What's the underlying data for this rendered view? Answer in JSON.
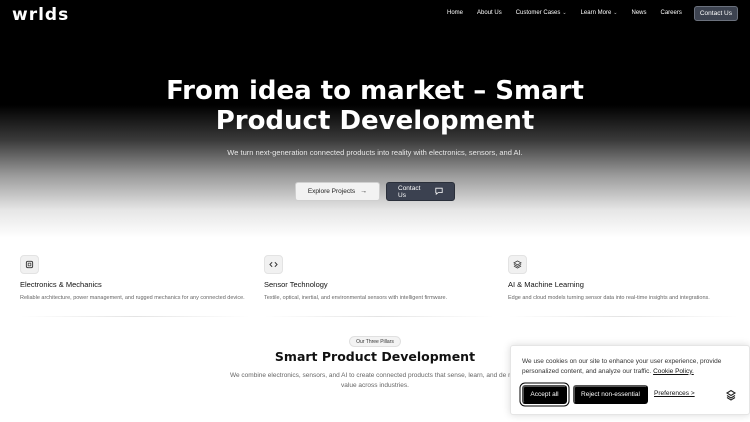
{
  "brand": {
    "logo": "wrlds"
  },
  "nav": {
    "items": [
      {
        "label": "Home",
        "has_dropdown": false
      },
      {
        "label": "About Us",
        "has_dropdown": false
      },
      {
        "label": "Customer Cases",
        "has_dropdown": true
      },
      {
        "label": "Learn More",
        "has_dropdown": true
      },
      {
        "label": "News",
        "has_dropdown": false
      },
      {
        "label": "Careers",
        "has_dropdown": false
      }
    ],
    "contact_label": "Contact Us"
  },
  "hero": {
    "title_line1": "From idea to market – Smart",
    "title_line2": "Product Development",
    "subtitle": "We turn next-generation connected products into reality with electronics, sensors, and AI.",
    "primary_button": {
      "label": "Explore Projects",
      "icon": "arrow-right-icon"
    },
    "secondary_button": {
      "label": "Contact Us",
      "icon": "message-icon"
    }
  },
  "features": [
    {
      "icon": "chip-icon",
      "title": "Electronics & Mechanics",
      "description": "Reliable architecture, power management, and rugged mechanics for any connected device."
    },
    {
      "icon": "code-icon",
      "title": "Sensor Technology",
      "description": "Textile, optical, inertial, and environmental sensors with intelligent firmware."
    },
    {
      "icon": "layers-icon",
      "title": "AI & Machine Learning",
      "description": "Edge and cloud models turning sensor data into real-time insights and integrations."
    }
  ],
  "pillars": {
    "badge": "Our Three Pillars",
    "title": "Smart Product Development",
    "description": "We combine electronics, sensors, and AI to create connected products that sense, learn, and de new value across industries."
  },
  "cookie": {
    "text": "We use cookies on our site to enhance your user experience, provide personalized content, and analyze our traffic.",
    "policy_link": "Cookie Policy.",
    "accept_label": "Accept all",
    "reject_label": "Reject non-essential",
    "preferences_label": "Preferences >"
  },
  "colors": {
    "hero_bg": "#000000",
    "contact_button_bg": "#3b4150",
    "cookie_button_bg": "#000000"
  }
}
